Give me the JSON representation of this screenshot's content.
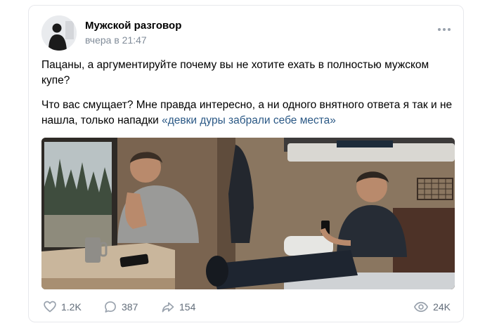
{
  "post": {
    "author": "Мужской разговор",
    "time": "вчера в 21:47",
    "paragraph1": "Пацаны, а аргументируйте почему вы не хотите ехать в полностью мужском купе?",
    "paragraph2_prefix": "Что вас смущает? Мне правда интересно, а ни одного внятного ответа я так и не нашла, только нападки ",
    "paragraph2_highlight": "«девки дуры забрали себе места»"
  },
  "icons": {
    "avatar": "man-silhouette-avatar",
    "more": "more-dots-icon",
    "like": "heart-icon",
    "comment": "comment-icon",
    "share": "share-arrow-icon",
    "views": "eye-icon"
  },
  "actions": {
    "likes": "1.2K",
    "comments": "387",
    "shares": "154",
    "views": "24K"
  },
  "colors": {
    "link": "#2a5885",
    "meta": "#818c99",
    "action": "#626d7a"
  }
}
